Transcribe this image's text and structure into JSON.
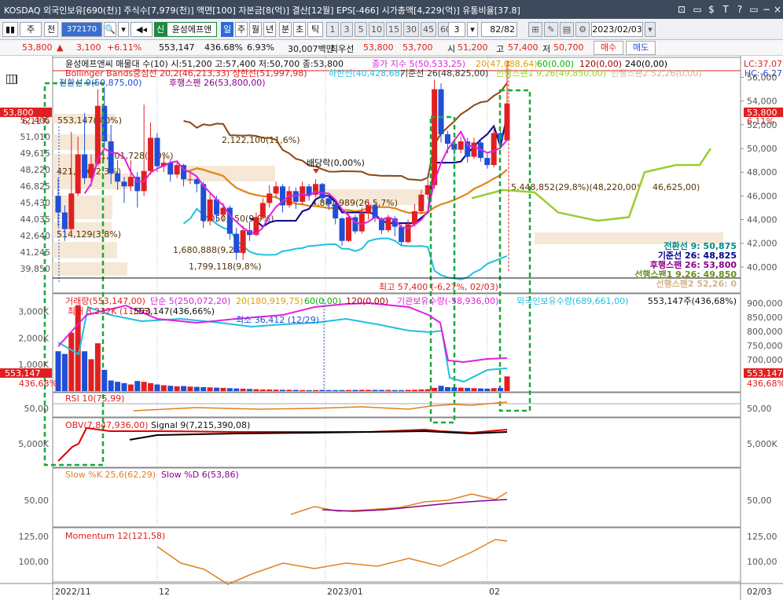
{
  "window": {
    "title": "KOSDAQ 외국인보유[690(천)] 주식수[7,979(천)] 액면[100] 자본금[8(억)] 결산[12월] EPS[-466] 시가총액[4,229(억)] 유통비율[37.8]",
    "buttons": [
      "⊡",
      "[]",
      "$",
      "T",
      "?",
      "[]",
      "−",
      "□",
      "×"
    ]
  },
  "toolbar": {
    "market": "주",
    "prev": "전",
    "code": "372170",
    "name": "윤성에프앤",
    "tag": "신",
    "period_tabs": [
      "일",
      "주",
      "월",
      "년",
      "분",
      "초",
      "틱"
    ],
    "active_period": "일",
    "nums": [
      "1",
      "3",
      "5",
      "10",
      "15",
      "30",
      "45",
      "60"
    ],
    "count": "3",
    "pages": "82/82",
    "date": "2023/02/03"
  },
  "quote": {
    "price": "53,800",
    "arrow": "▲",
    "change": "3,100",
    "pct": "+6.11%",
    "volume": "553,147",
    "vol_pct": "436.68%",
    "turnover": "6.93%",
    "amount": "30,007백만",
    "best_label": "최우선",
    "ask": "53,800",
    "bid": "53,700",
    "open_label": "시",
    "open": "51,200",
    "high_label": "고",
    "high": "57,400",
    "low_label": "저",
    "low": "50,700",
    "buy": "매수",
    "sell": "매도"
  },
  "colors": {
    "up": "#e02020",
    "down": "#1f4fd6",
    "ma5": "#e020e0",
    "ma20": "#e0a000",
    "ma60": "#00b000",
    "bb_mid": "#e00000",
    "bb_up": "#8b4513",
    "bb_dn": "#20c0e0",
    "conv": "#00008b",
    "base": "#8b4513",
    "span1": "#9acd32",
    "box": "#f5e6d2"
  },
  "price_panel": {
    "header1": "윤성에프앤씨 매물대 수(10)  시:51,200 고:57,400 저:50,700 종:53,800",
    "header1b": "종가 지수 5(50,533,25)",
    "header1c": "20(47,088,64)",
    "header1d": "60(0,00)",
    "header1e": "120(0,00)",
    "header1f": "240(0,00)",
    "header2": "Bollinger Bands중심선 20,2(46,213,33)  상한선(51,997,98)",
    "header2b": "하한선(40,428,68)",
    "header2c": "기준선 26(48,825,00)",
    "header2d": "선행스팬1 9,26(49,850,00)",
    "header2e": "선행스팬2 52,26(0,00)",
    "header3": "전환선 9(50,875,00)",
    "header3b": "후행스팬 26(53,800,00)",
    "lc": "LC:37,07",
    "hc": "HC:-6,27",
    "y_ticks": [
      "56,000",
      "54,000",
      "52,000",
      "50,000",
      "48,000",
      "46,000",
      "44,000",
      "42,000",
      "40,000"
    ],
    "left_ticks": [
      "52,405",
      "51,010",
      "49,615",
      "48,220",
      "46,825",
      "45,430",
      "44,035",
      "42,640",
      "41,245",
      "39,850"
    ],
    "price_tag": "53,800",
    "price_pct": "6,11%",
    "right_tag": "53,800",
    "right_pct": "6,11%",
    "boxes": [
      "553,147(3,0%)",
      "1,101,728(6,0%)",
      "2,122,100(11,6%)",
      "421,096(2,3%)",
      "5,448,852(29,8%)(48,220,00)",
      "46,625,00)",
      "4,801,989(26,5,7%)",
      "3,050,150(9,9%)",
      "1,680,888(9,2%)",
      "1,799,118(9,8%)",
      "514,129(3,8%)"
    ],
    "dividend": "배당락(0,00%)",
    "hi_label": "최고 57,400 (-6,27%, 02/03)",
    "legend": [
      {
        "t": "전환선 9: 50,875",
        "c": "#008b8b"
      },
      {
        "t": "기준선 26: 48,825",
        "c": "#00008b"
      },
      {
        "t": "후행스팬 26: 53,800",
        "c": "#8b008b"
      },
      {
        "t": "선행스팬1 9,26: 49,850",
        "c": "#6b8e23"
      },
      {
        "t": "선행스팬2 52,26: 0",
        "c": "#d2b48c"
      }
    ]
  },
  "volume_panel": {
    "header": "거래량(553,147,00)",
    "h_b": "단순 5(250,072,20)",
    "h_c": "20(180,919,75)",
    "h_d": "60(0,00)",
    "h_e": "120(0,00)",
    "h_f": "기관보유수량(-58,936,00)",
    "h_g": "외국인보유수량(689,661,00)",
    "right_val": "553,147주(436,68%)",
    "y_ticks": [
      "3,000K",
      "2,000K",
      "1,000K"
    ],
    "r_ticks": [
      "900,000",
      "850,000",
      "800,000",
      "750,000",
      "700,000",
      "650,000"
    ],
    "max_label": "최대 3,232K (11/16)",
    "max_label_b": "553,147(436,66%)",
    "min_label": "최소 36,412 (12/29)",
    "tag": "553,147",
    "tag_pct": "436,68%",
    "rtag": "553,147",
    "rtag_pct": "436,68%"
  },
  "rsi_panel": {
    "header": "RSI 10(75,99)",
    "y": "50,00",
    "ry": "50,00"
  },
  "obv_panel": {
    "header": "OBV(7,847,936,00)",
    "header_b": "Signal 9(7,215,390,08)",
    "y": "5,000K",
    "ry": "5,000K"
  },
  "stoch_panel": {
    "header": "Slow %K 25,6(62,29)",
    "header_b": "Slow %D 6(53,86)",
    "y": "50,00",
    "ry": "50,00"
  },
  "mom_panel": {
    "header": "Momentum 12(121,58)",
    "y1": "125,00",
    "y2": "100,00",
    "ry1": "125,00",
    "ry2": "100,00"
  },
  "x_axis": {
    "labels": [
      "2022/11",
      "12",
      "2023/01",
      "02"
    ],
    "right": "02/03"
  },
  "chart_data": {
    "type": "candlestick",
    "candles": [
      [
        46,
        44.6,
        47.5,
        43.4
      ],
      [
        44.6,
        43.2,
        45.2,
        42.2
      ],
      [
        43.2,
        46.2,
        51.4,
        42.5
      ],
      [
        46.2,
        49.5,
        51,
        46
      ],
      [
        49.5,
        47.5,
        53,
        47
      ],
      [
        47.5,
        48.7,
        49.5,
        46.8
      ],
      [
        48.7,
        53.6,
        55,
        48.5
      ],
      [
        53.6,
        50.6,
        55.2,
        50
      ],
      [
        50.6,
        47.9,
        52,
        47
      ],
      [
        47.9,
        47.2,
        49,
        46.5
      ],
      [
        47.2,
        46.8,
        47.6,
        45.4
      ],
      [
        46.8,
        47.6,
        49,
        46.4
      ],
      [
        47.6,
        46.4,
        48,
        45
      ],
      [
        46.4,
        48.1,
        53.7,
        46
      ],
      [
        48.1,
        50.9,
        52.2,
        47.8
      ],
      [
        50.9,
        48.5,
        51.3,
        48
      ],
      [
        48.5,
        48.8,
        49.5,
        48
      ],
      [
        48.8,
        47.8,
        49.1,
        47.2
      ],
      [
        47.8,
        48.6,
        48.9,
        47.5
      ],
      [
        48.6,
        47.4,
        48.7,
        46.8
      ],
      [
        47.4,
        47.4,
        48,
        47
      ],
      [
        47.4,
        47,
        47.6,
        46.3
      ],
      [
        47,
        43.9,
        47.2,
        43.3
      ],
      [
        43.9,
        45.7,
        46.2,
        43.5
      ],
      [
        45.7,
        44.4,
        46,
        43.8
      ],
      [
        44.4,
        45,
        45.4,
        43.9
      ],
      [
        45,
        42.8,
        45.2,
        42.3
      ],
      [
        42.8,
        41.2,
        43.3,
        40.6
      ],
      [
        41.2,
        43.1,
        43.5,
        40.6
      ],
      [
        43.1,
        42.7,
        43.8,
        42.2
      ],
      [
        42.7,
        44.2,
        44.6,
        42.6
      ],
      [
        44.2,
        45.4,
        45.8,
        44
      ],
      [
        45.4,
        46.2,
        46.9,
        45
      ],
      [
        46.2,
        46.8,
        47.2,
        45.8
      ],
      [
        46.8,
        45.2,
        47,
        44.6
      ],
      [
        45.2,
        46.4,
        46.8,
        45
      ],
      [
        46.4,
        45.5,
        46.7,
        44.9
      ],
      [
        45.5,
        46.8,
        47.2,
        45.2
      ],
      [
        46.8,
        46.1,
        47,
        45.6
      ],
      [
        46.1,
        47,
        47.4,
        45.9
      ],
      [
        47,
        45.8,
        47.1,
        45.5
      ],
      [
        45.8,
        45.3,
        46,
        44.8
      ],
      [
        45.3,
        44.1,
        45.5,
        43.6
      ],
      [
        44.1,
        42.2,
        44.2,
        41.8
      ],
      [
        42.2,
        44.2,
        44.5,
        42.1
      ],
      [
        44.2,
        43,
        44.4,
        42.8
      ],
      [
        43,
        44.5,
        45,
        42.8
      ],
      [
        44.5,
        45.2,
        45.6,
        44
      ],
      [
        45.2,
        44.1,
        45.4,
        43.8
      ],
      [
        44.1,
        43.1,
        44.2,
        42.8
      ],
      [
        43.1,
        44.1,
        44.4,
        42.9
      ],
      [
        44.1,
        43.4,
        44.3,
        42.6
      ],
      [
        43.4,
        42.1,
        43.6,
        41.8
      ],
      [
        42.1,
        43.6,
        44,
        42
      ],
      [
        43.6,
        44.7,
        45.3,
        43.4
      ],
      [
        44.7,
        46.1,
        46.5,
        44.5
      ],
      [
        46.1,
        46.9,
        47.4,
        45.7
      ],
      [
        46.9,
        55,
        55.8,
        46.6
      ],
      [
        55,
        51.2,
        55.5,
        50.5
      ],
      [
        51.2,
        50.4,
        51.5,
        49.6
      ],
      [
        50.4,
        49.9,
        50.8,
        49.4
      ],
      [
        49.9,
        50.6,
        51,
        49.6
      ],
      [
        50.6,
        49.3,
        50.9,
        48.8
      ],
      [
        49.3,
        50.5,
        50.9,
        49.1
      ],
      [
        50.5,
        49.2,
        50.8,
        48.9
      ],
      [
        49.2,
        48.6,
        49.6,
        48.3
      ],
      [
        48.6,
        51.3,
        52,
        48.4
      ],
      [
        51.3,
        50.7,
        51.6,
        50.4
      ],
      [
        50.7,
        53.8,
        57.4,
        50.7
      ]
    ],
    "volume": [
      1500,
      1400,
      2200,
      3232,
      1500,
      1200,
      1800,
      800,
      400,
      350,
      300,
      250,
      380,
      350,
      300,
      250,
      220,
      200,
      180,
      190,
      170,
      160,
      150,
      140,
      130,
      120,
      110,
      100,
      90,
      80,
      70,
      60,
      60,
      55,
      50,
      50,
      45,
      40,
      36,
      40,
      45,
      40,
      38,
      40,
      42,
      45,
      50,
      48,
      46,
      44,
      45,
      40,
      38,
      45,
      50,
      60,
      70,
      120,
      200,
      150,
      140,
      130,
      120,
      110,
      100,
      90,
      110,
      120,
      553
    ],
    "y_range_price": [
      39,
      56.5
    ],
    "y_unit": "천원"
  }
}
